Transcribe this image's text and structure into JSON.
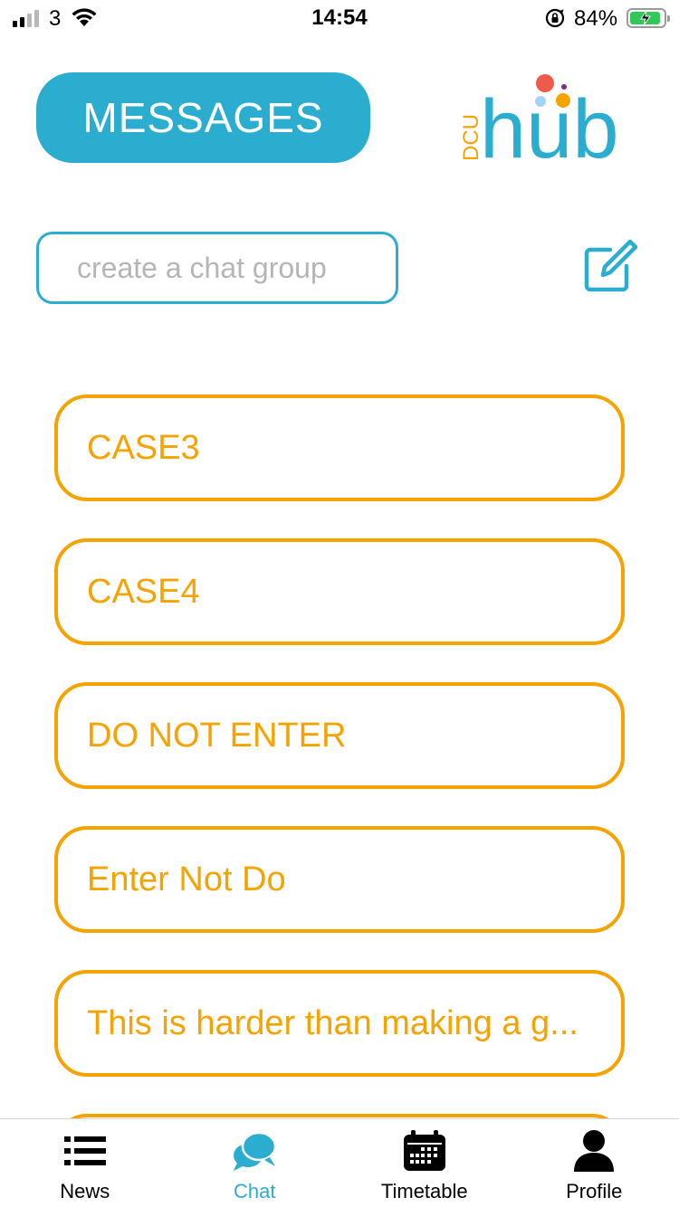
{
  "status_bar": {
    "carrier": "3",
    "time": "14:54",
    "battery_percent": "84%",
    "signal_bars_filled": 2,
    "signal_bars_total": 4,
    "battery_level": 0.84
  },
  "header": {
    "title": "MESSAGES",
    "logo": {
      "prefix": "DCU",
      "word": "hub",
      "colors": [
        "#2badcf",
        "#f5a300",
        "#f05a4a",
        "#a3d4f3",
        "#7b2d8e"
      ]
    }
  },
  "create_group": {
    "placeholder": "create a chat group",
    "value": "",
    "compose_icon": "compose-icon"
  },
  "groups": [
    {
      "name": "CASE3"
    },
    {
      "name": "CASE4"
    },
    {
      "name": "DO NOT ENTER"
    },
    {
      "name": "Enter Not Do"
    },
    {
      "name": "This is harder than making a g..."
    },
    {
      "name": ""
    }
  ],
  "tabs": [
    {
      "label": "News",
      "icon": "list-icon",
      "active": false
    },
    {
      "label": "Chat",
      "icon": "chat-bubbles-icon",
      "active": true
    },
    {
      "label": "Timetable",
      "icon": "calendar-icon",
      "active": false
    },
    {
      "label": "Profile",
      "icon": "person-icon",
      "active": false
    }
  ],
  "colors": {
    "accent": "#2badcf",
    "group_orange": "#f5a300",
    "placeholder_gray": "#b5b5b5"
  }
}
